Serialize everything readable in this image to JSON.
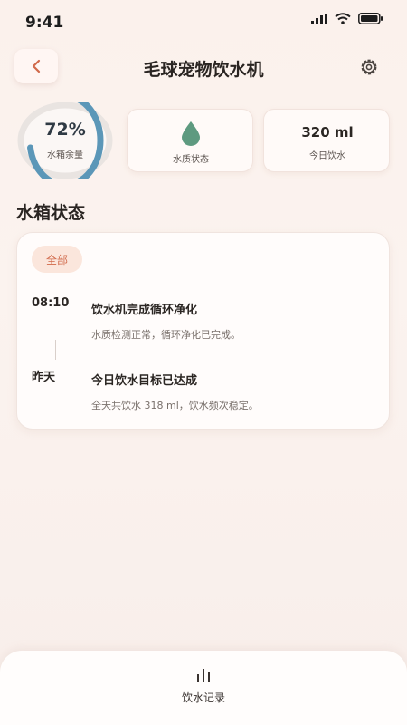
{
  "status_bar": {
    "time": "9:41"
  },
  "header": {
    "title": "毛球宠物饮水机"
  },
  "summary": {
    "tank": {
      "percent": 72,
      "value": "72%",
      "label": "水箱余量"
    },
    "water_quality": {
      "label": "水质状态",
      "icon": "water-drop-icon"
    },
    "daily_intake": {
      "value": "320 ml",
      "label": "今日饮水"
    }
  },
  "section": {
    "title": "水箱状态"
  },
  "filter": {
    "selected": "全部"
  },
  "timeline": [
    {
      "time": "08:10",
      "title": "饮水机完成循环净化",
      "desc": "水质检测正常，循环净化已完成。"
    },
    {
      "time": "昨天",
      "title": "今日饮水目标已达成",
      "desc": "全天共饮水 318 ml，饮水频次稳定。"
    }
  ],
  "bottom_nav": {
    "label": "饮水记录",
    "icon": "bar-chart-icon"
  },
  "colors": {
    "accent": "#d1694a",
    "ring": "#5b97b8",
    "drop": "#5e9a80"
  }
}
